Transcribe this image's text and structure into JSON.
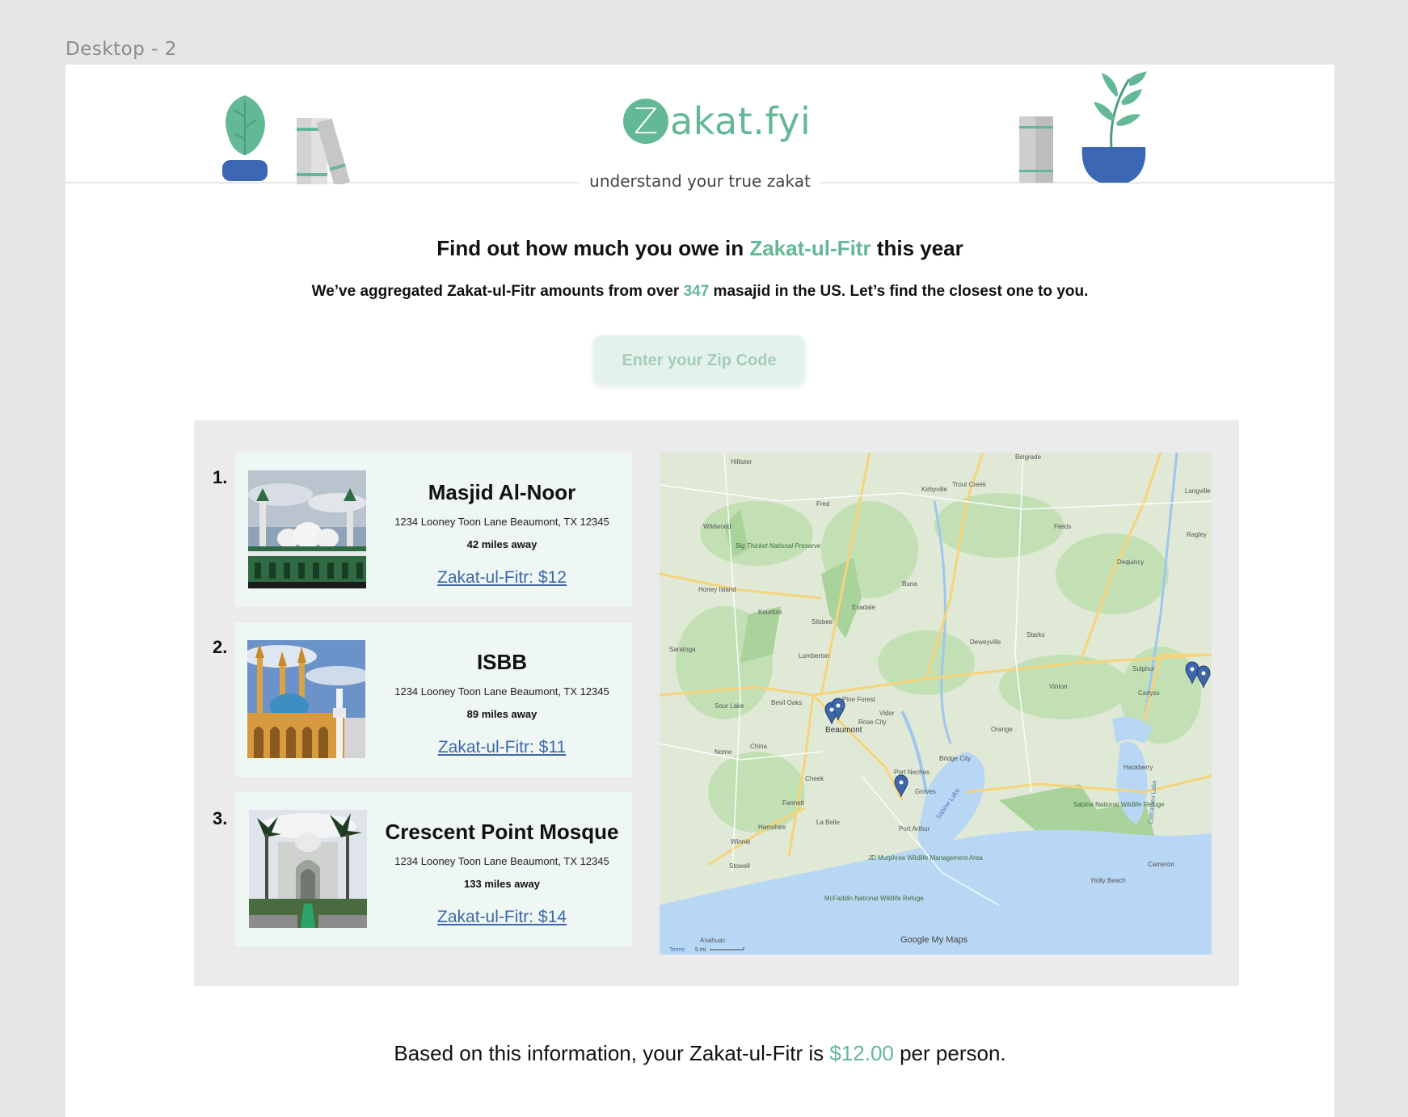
{
  "frame_label": "Desktop - 2",
  "brand": {
    "logo_letter": "Z",
    "logo_rest": "akat.fyi",
    "tagline": "understand your  true zakat",
    "accent_color": "#63b896",
    "link_color": "#3f67a8"
  },
  "hero": {
    "headline_prefix": "Find out how much you owe in ",
    "headline_accent": "Zakat-ul-Fitr",
    "headline_suffix": " this year",
    "sub_prefix": "We’ve aggregated Zakat-ul-Fitr amounts from over ",
    "sub_count": "347",
    "sub_suffix": " masajid in the US. Let’s find the closest one to you."
  },
  "search": {
    "placeholder": "Enter your Zip Code",
    "value": ""
  },
  "results": [
    {
      "rank": "1.",
      "name": "Masjid Al-Noor",
      "address": "1234 Looney Toon Lane Beaumont, TX 12345",
      "distance": "42 miles away",
      "zakat": "Zakat-ul-Fitr: $12"
    },
    {
      "rank": "2.",
      "name": "ISBB",
      "address": "1234 Looney Toon Lane Beaumont, TX 12345",
      "distance": "89 miles away",
      "zakat": "Zakat-ul-Fitr: $11"
    },
    {
      "rank": "3.",
      "name": "Crescent Point Mosque",
      "address": "1234 Looney Toon Lane Beaumont, TX 12345",
      "distance": "133 miles away",
      "zakat": "Zakat-ul-Fitr: $14"
    }
  ],
  "map": {
    "places": [
      "Beaumont",
      "Port Arthur",
      "Orange",
      "Vidor",
      "Bridge City",
      "Lumberton",
      "Silsbee",
      "Nome",
      "China",
      "Winnie",
      "Hackberry",
      "Sulphur",
      "Vinton",
      "Deweyville",
      "Starks",
      "Buna",
      "Kirbyville",
      "Fred",
      "Kountze",
      "Saratoga",
      "Hamshire",
      "Fannett",
      "Groves",
      "Port Neches",
      "Sabine Lake",
      "Sabine National Wildlife Refuge",
      "Calcasieu Lake",
      "Big Thicket National Preserve",
      "Honey Island",
      "Wildwood",
      "Cheek",
      "La Belle",
      "Stowell",
      "Anahuac",
      "Carlyss",
      "Dequincy",
      "Ragley",
      "Longville",
      "Fields",
      "Evadale",
      "Rose City",
      "Pine Forest",
      "Sour Lake",
      "Bevil Oaks",
      "Hillister",
      "Holly Beach",
      "Cameron",
      "JD Murphree Wildlife Management Area",
      "McFaddin National Wildlife Refuge",
      "Trout Creek",
      "Belgrade"
    ],
    "attribution": "Google My Maps",
    "terms": "Terms",
    "scale": "5 mi"
  },
  "summary": {
    "prefix": "Based on this information, your Zakat-ul-Fitr is ",
    "amount": "$12.00",
    "suffix": " per person."
  }
}
